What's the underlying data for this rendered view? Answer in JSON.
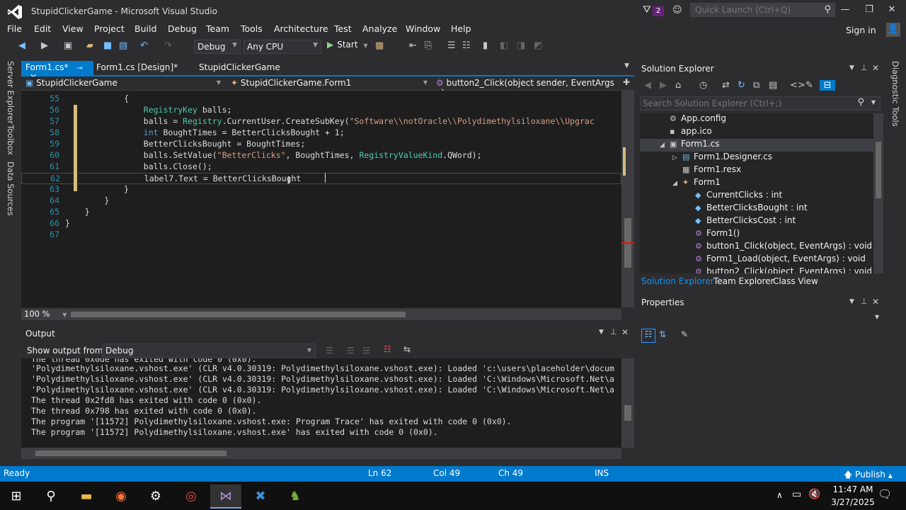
{
  "window": {
    "title": "StupidClickerGame - Microsoft Visual Studio",
    "notification_count": "2",
    "quick_launch_placeholder": "Quick Launch (Ctrl+Q)"
  },
  "menu": [
    "File",
    "Edit",
    "View",
    "Project",
    "Build",
    "Debug",
    "Team",
    "Tools",
    "Architecture",
    "Test",
    "Analyze",
    "Window",
    "Help"
  ],
  "signin_label": "Sign in",
  "toolbar": {
    "config": "Debug",
    "platform": "Any CPU",
    "start_label": "Start"
  },
  "doc_tabs": {
    "active": "Form1.cs*",
    "design": "Form1.cs [Design]*",
    "project": "StupidClickerGame"
  },
  "navbar": {
    "project": "StupidClickerGame",
    "class": "StupidClickerGame.Form1",
    "member": "button2_Click(object sender, EventArgs e)"
  },
  "side_tabs": [
    "Server Explorer",
    "Toolbox",
    "Data Sources"
  ],
  "right_side_tab": "Diagnostic Tools",
  "editor": {
    "lines": [
      {
        "num": "55",
        "indent": "",
        "tokens": [
          [
            "",
            "            {"
          ]
        ]
      },
      {
        "num": "56",
        "tokens": [
          [
            "",
            "                "
          ],
          [
            "ty",
            "RegistryKey"
          ],
          [
            "",
            " balls;"
          ]
        ]
      },
      {
        "num": "57",
        "tokens": [
          [
            "",
            "                balls = "
          ],
          [
            "ty",
            "Registry"
          ],
          [
            "",
            ".CurrentUser.CreateSubKey("
          ],
          [
            "str",
            "\"Software\\\\notOracle\\\\Polydimethylsiloxane\\\\Upgrac"
          ]
        ]
      },
      {
        "num": "58",
        "tokens": [
          [
            "",
            "                "
          ],
          [
            "kw",
            "int"
          ],
          [
            "",
            " BoughtTimes = BetterClicksBought + 1;"
          ]
        ]
      },
      {
        "num": "59",
        "tokens": [
          [
            "",
            "                BetterClicksBought = BoughtTimes;"
          ]
        ]
      },
      {
        "num": "60",
        "tokens": [
          [
            "",
            "                balls.SetValue("
          ],
          [
            "str",
            "\"BetterClicks\""
          ],
          [
            "",
            ", BoughtTimes, "
          ],
          [
            "ty",
            "RegistryValueKind"
          ],
          [
            "",
            ".QWord);"
          ]
        ]
      },
      {
        "num": "61",
        "tokens": [
          [
            "",
            "                balls.Close();"
          ]
        ]
      },
      {
        "num": "62",
        "tokens": [
          [
            "",
            "                label7.Text = BetterClicksBought"
          ]
        ]
      },
      {
        "num": "63",
        "tokens": [
          [
            "",
            "            }"
          ]
        ]
      },
      {
        "num": "64",
        "tokens": [
          [
            "",
            "        }"
          ]
        ]
      },
      {
        "num": "65",
        "tokens": [
          [
            "",
            "    }"
          ]
        ]
      },
      {
        "num": "66",
        "tokens": [
          [
            "",
            "}"
          ]
        ]
      },
      {
        "num": "67",
        "tokens": [
          [
            "",
            ""
          ]
        ]
      }
    ],
    "zoom": "100 %"
  },
  "output": {
    "title": "Output",
    "show_from_label": "Show output from:",
    "source": "Debug",
    "lines": [
      "'Polydimethylsiloxane.vshost.exe' (CLR v4.0.30319: Polydimethylsiloxane.vshost.exe): Loaded 'c:\\users\\placeholder\\docum",
      "'Polydimethylsiloxane.vshost.exe' (CLR v4.0.30319: Polydimethylsiloxane.vshost.exe): Loaded 'C:\\Windows\\Microsoft.Net\\a",
      "'Polydimethylsiloxane.vshost.exe' (CLR v4.0.30319: Polydimethylsiloxane.vshost.exe): Loaded 'C:\\Windows\\Microsoft.Net\\a",
      "The thread 0x2fd8 has exited with code 0 (0x0).",
      "The thread 0x798 has exited with code 0 (0x0).",
      "The program '[11572] Polydimethylsiloxane.vshost.exe: Program Trace' has exited with code 0 (0x0).",
      "The program '[11572] Polydimethylsiloxane.vshost.exe' has exited with code 0 (0x0)."
    ]
  },
  "solution_explorer": {
    "title": "Solution Explorer",
    "search_placeholder": "Search Solution Explorer (Ctrl+;)",
    "nodes": [
      {
        "label": "App.config",
        "depth": 1,
        "exp": "",
        "icon": "config-icon"
      },
      {
        "label": "app.ico",
        "depth": 1,
        "exp": "",
        "icon": "ico-file-icon"
      },
      {
        "label": "Form1.cs",
        "depth": 1,
        "exp": "◢",
        "icon": "form-icon",
        "selected": true
      },
      {
        "label": "Form1.Designer.cs",
        "depth": 2,
        "exp": "▷",
        "icon": "csharp-file-icon"
      },
      {
        "label": "Form1.resx",
        "depth": 2,
        "exp": "",
        "icon": "resx-icon"
      },
      {
        "label": "Form1",
        "depth": 2,
        "exp": "◢",
        "icon": "class-icon"
      },
      {
        "label": "CurrentClicks : int",
        "depth": 3,
        "exp": "",
        "icon": "field-icon"
      },
      {
        "label": "BetterClicksBought : int",
        "depth": 3,
        "exp": "",
        "icon": "field-icon"
      },
      {
        "label": "BetterClicksCost : int",
        "depth": 3,
        "exp": "",
        "icon": "field-icon"
      },
      {
        "label": "Form1()",
        "depth": 3,
        "exp": "",
        "icon": "method-icon"
      },
      {
        "label": "button1_Click(object, EventArgs) : void",
        "depth": 3,
        "exp": "",
        "icon": "method-icon"
      },
      {
        "label": "Form1_Load(object, EventArgs) : void",
        "depth": 3,
        "exp": "",
        "icon": "method-icon"
      },
      {
        "label": "button2_Click(object, EventArgs) : void",
        "depth": 3,
        "exp": "",
        "icon": "method-icon"
      }
    ],
    "tabs": [
      "Solution Explorer",
      "Team Explorer",
      "Class View"
    ]
  },
  "properties": {
    "title": "Properties"
  },
  "statusbar": {
    "state": "Ready",
    "line": "Ln 62",
    "col": "Col 49",
    "ch": "Ch 49",
    "mode": "INS",
    "publish": "Publish"
  },
  "taskbar": {
    "time": "11:47 AM",
    "date": "3/27/2025"
  },
  "colors": {
    "accent": "#007acc",
    "type": "#4ec9b0",
    "keyword": "#569cd6",
    "string": "#d69d85",
    "line_number": "#2b91af"
  }
}
